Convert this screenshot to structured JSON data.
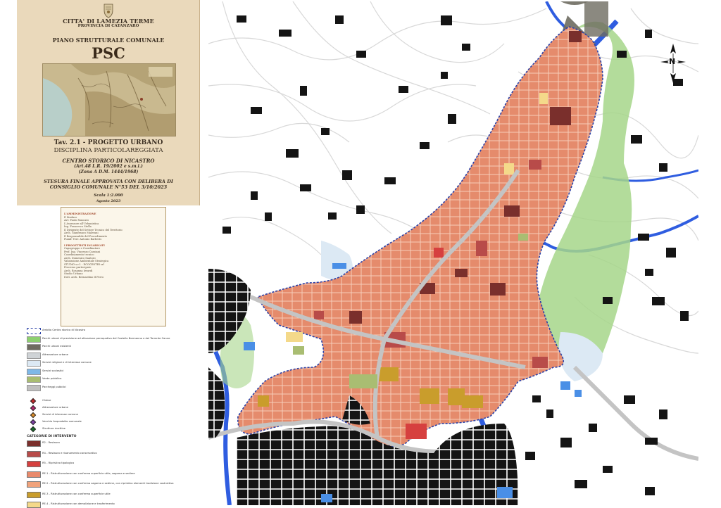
{
  "title_block": {
    "city": "CITTA' DI LAMEZIA TERME",
    "province": "PROVINCIA DI CATANZARO",
    "plan": "PIANO STRUTTURALE COMUNALE",
    "acronym": "PSC",
    "table": "Tav. 2.1 - PROGETTO URBANO",
    "discipline": "DISCIPLINA PARTICOLAREGGIATA",
    "centro": "CENTRO STORICO DI NICASTRO",
    "article": "(Art.48 L.R. 19/2002 e s.m.i.)",
    "zone": "(Zona A   D.M. 1444/1968)",
    "approval_1": "STESURA FINALE APPROVATA CON DELIBERA DI",
    "approval_2": "CONSIGLIO COMUNALE N°53 DEL 3/10/2023",
    "scale": "Scala 1:2.000",
    "date": "Agosto 2023"
  },
  "credits": [
    {
      "heading": true,
      "text": "L'AMMINISTRAZIONE"
    },
    {
      "heading": false,
      "text": "Il Sindaco"
    },
    {
      "heading": false,
      "text": "Avv. Paolo Mascaro"
    },
    {
      "heading": false,
      "text": "L'Assessore all'Urbanistica"
    },
    {
      "heading": false,
      "text": "Ing. Francesco Stella"
    },
    {
      "heading": false,
      "text": "Il Dirigente del Settore Tecnico del Territorio"
    },
    {
      "heading": false,
      "text": "Arch. Gianfranco Malerani"
    },
    {
      "heading": false,
      "text": "Il Responsabile del Procedimento"
    },
    {
      "heading": false,
      "text": "Pianif. Terr. Antonio Barberis"
    },
    {
      "heading": true,
      "text": "I PROGETTISTI INCARICATI"
    },
    {
      "heading": false,
      "text": "Capogruppo e Coordinatore"
    },
    {
      "heading": false,
      "text": "Prof. Ing. Vincenzo Cassiani"
    },
    {
      "heading": false,
      "text": "Coordinamento tecnico"
    },
    {
      "heading": false,
      "text": "Arch. Domenico Santoro"
    },
    {
      "heading": false,
      "text": "Valutazione Ambientale Strategica"
    },
    {
      "heading": false,
      "text": "STUDIO s.r.l. - ECOCENTRI srl"
    },
    {
      "heading": false,
      "text": "Processo partecipato"
    },
    {
      "heading": false,
      "text": "Arch. Rosanna Ierardi"
    },
    {
      "heading": false,
      "text": "Studio Urbano"
    },
    {
      "heading": false,
      "text": "Dott. arch. Bernardino Il Ferro"
    }
  ],
  "legend": {
    "areas": [
      {
        "label": "Ambito Centro storico di Nicastro",
        "color": "#ffffff",
        "border": "#2a41a8",
        "dashed": true
      },
      {
        "label": "Parchi urbani di previsione ad attuazione perequativa del Castello Normanno e del Torrente Canne",
        "color": "#8ccf6f"
      },
      {
        "label": "Parchi urbani esistenti",
        "color": "#6e6b60"
      },
      {
        "label": "Attrezzature urbane",
        "color": "#cfd3d6"
      },
      {
        "label": "Servizi religiosi e di interesse comune",
        "color": "#dce9f4"
      },
      {
        "label": "Servizi scolastici",
        "color": "#7eb8e8"
      },
      {
        "label": "Verde pubblico",
        "color": "#a9bd72"
      },
      {
        "label": "Parcheggi pubblici",
        "color": "#bfbfbf"
      }
    ],
    "points": [
      {
        "label": "Chiese",
        "color": "#c02a2a"
      },
      {
        "label": "Attrezzature urbane",
        "color": "#b22a6e"
      },
      {
        "label": "Servizi di interesse comune",
        "color": "#d88a2a"
      },
      {
        "label": "Vecchio Acquedotto comunale",
        "color": "#7a3fa0"
      },
      {
        "label": "Strutture ricettive",
        "color": "#1a6b2a"
      }
    ],
    "categories_title": "CATEGORIE DI INTERVENTO",
    "categories": [
      {
        "label": "R2 - Restauro",
        "color": "#7a2f2c"
      },
      {
        "label": "R4 - Restauro e risanamento conservativo",
        "color": "#b84b49"
      },
      {
        "label": "R5 - Ripristino tipologico",
        "color": "#d6403f"
      },
      {
        "label": "RE.1 - Ristrutturazione con conferma superficie utile, sagoma e sedime",
        "color": "#e88a6c"
      },
      {
        "label": "RE.2 - Ristrutturazione con conferma sagoma e sedime, con ripristino elementi tradizione costruttiva",
        "color": "#f0a37c"
      },
      {
        "label": "RE.3 - Ristrutturazione con conferma superficie utile",
        "color": "#c99d2c"
      },
      {
        "label": "RE.4 - Ristrutturazione con demolizione e trasferimento",
        "color": "#f4d98a"
      }
    ]
  },
  "map": {
    "north_label": "N"
  }
}
